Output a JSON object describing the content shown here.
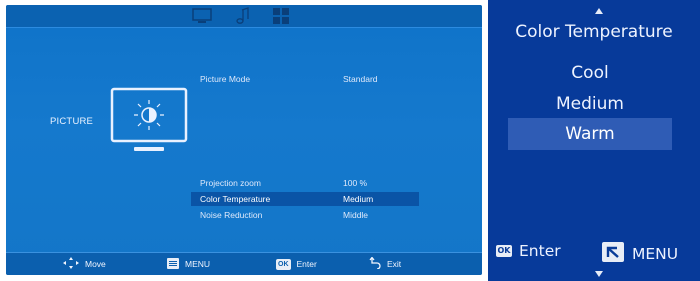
{
  "tv_menu": {
    "category_label": "PICTURE",
    "tabs": [
      {
        "name": "monitor-tab-icon"
      },
      {
        "name": "music-tab-icon"
      },
      {
        "name": "grid-tab-icon"
      }
    ],
    "rows": [
      {
        "label": "Picture Mode",
        "value": "Standard"
      },
      {
        "label": "Projection zoom",
        "value": "100 %"
      },
      {
        "label": "Color Temperature",
        "value": "Medium"
      },
      {
        "label": "Noise Reduction",
        "value": "Middle"
      }
    ],
    "hints": {
      "move": "Move",
      "menu": "MENU",
      "ok_badge": "OK",
      "enter": "Enter",
      "exit": "Exit"
    }
  },
  "color_temp_menu": {
    "title": "Color Temperature",
    "options": [
      "Cool",
      "Medium",
      "Warm"
    ],
    "selected": "Warm",
    "footer": {
      "ok_badge": "OK",
      "enter": "Enter",
      "menu": "MENU"
    }
  },
  "colors": {
    "tv_panel_blue": "#1376c8",
    "selected_row": "#0a54a6",
    "submenu_bg": "#073a9a",
    "submenu_highlight": "#2f5cb5"
  }
}
